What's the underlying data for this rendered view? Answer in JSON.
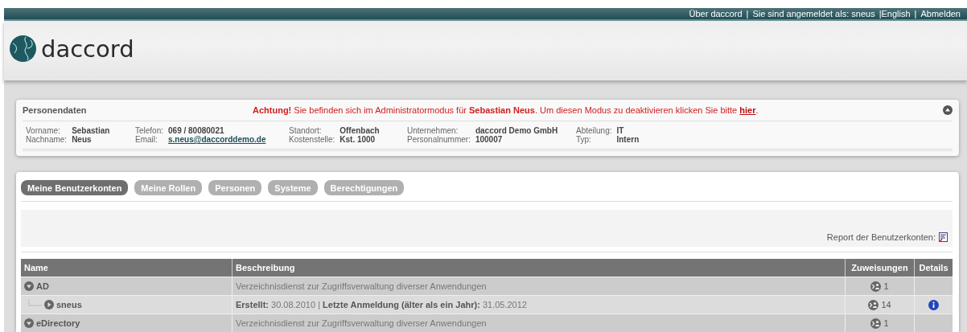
{
  "top_nav": [
    "Über daccord",
    "|",
    "Sie sind angemeldet als: sneus",
    "|English",
    "|",
    "Abmelden"
  ],
  "logo": {
    "text": "daccord"
  },
  "person_panel": {
    "title": "Personendaten",
    "notice": "**Achtung!** Sie befinden sich im Administratormodus für **Sebastian Neus**.  Um diesen Modus zu deaktivieren klicken Sie bitte ",
    "notice_link": "hier",
    "notice_end": ".",
    "groups": [
      [
        {
          "label": "Vorname:",
          "value": "Sebastian"
        },
        {
          "label": "Nachname:",
          "value": "Neus"
        }
      ],
      [
        {
          "label": "Telefon:",
          "value": "069 / 80080021"
        },
        {
          "label": "Email:",
          "value": "s.neus@daccorddemo.de",
          "kind": "link"
        }
      ],
      [
        {
          "label": "Standort:",
          "value": "Offenbach"
        },
        {
          "label": "Kostenstelle:",
          "value": "Kst. 1000"
        }
      ],
      [
        {
          "label": "Unternehmen:",
          "value": "daccord Demo GmbH"
        },
        {
          "label": "Personalnummer:",
          "value": "100007"
        }
      ],
      [
        {
          "label": "Abteilung:",
          "value": "IT"
        },
        {
          "label": "Typ:",
          "value": "Intern"
        }
      ]
    ]
  },
  "tabs": [
    {
      "label": "Meine Benutzerkonten",
      "selected": true
    },
    {
      "label": "Meine Rollen",
      "selected": false
    },
    {
      "label": "Personen",
      "selected": false
    },
    {
      "label": "Systeme",
      "selected": false
    },
    {
      "label": "Berechtigungen",
      "selected": false
    }
  ],
  "report": {
    "label": "Report der Benutzerkonten:"
  },
  "table": {
    "columns": [
      "Name",
      "Beschreibung",
      "Zuweisungen",
      "Details"
    ],
    "rows": [
      {
        "name": "AD",
        "description": "Verzeichnisdienst zur Zugriffsverwaltung diverser Anwendungen",
        "assignments": "1",
        "details": false,
        "expanded": true,
        "children": [
          {
            "name": "sneus",
            "description": "**Erstellt:** 30.08.2010  |  **Letzte Anmeldung (älter als ein Jahr):** 31.05.2012",
            "assignments": "14",
            "details": true,
            "expanded": false
          }
        ]
      },
      {
        "name": "eDirectory",
        "description": "Verzeichnisdienst zur Zugriffsverwaltung diverser Anwendungen",
        "assignments": "1",
        "details": false,
        "expanded": true
      }
    ]
  }
}
